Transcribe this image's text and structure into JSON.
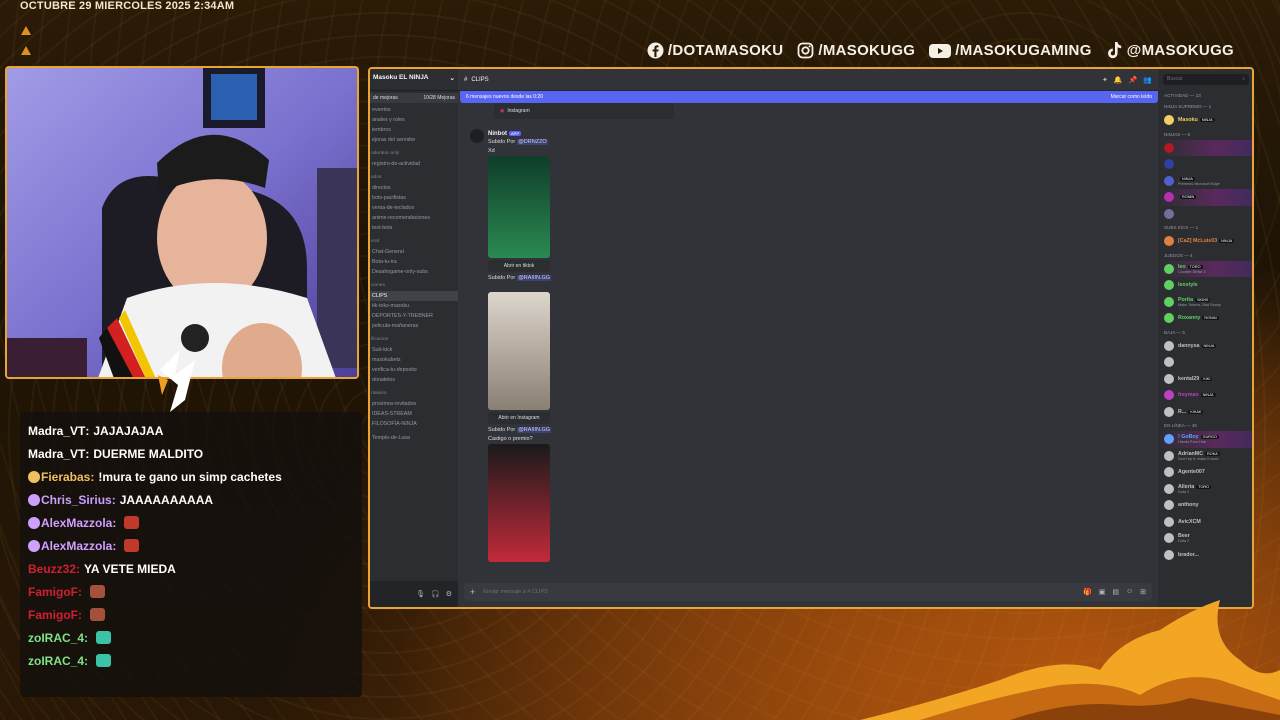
{
  "overlay": {
    "datetime": "OCTUBRE 29 MIERCOLES 2025 2:34AM",
    "socials": [
      {
        "icon": "facebook-icon",
        "label": "/DOTAMASOKU"
      },
      {
        "icon": "instagram-icon",
        "label": "/MASOKUGG"
      },
      {
        "icon": "youtube-icon",
        "label": "/MASOKUGAMING"
      },
      {
        "icon": "tiktok-icon",
        "label": "@MASOKUGG"
      }
    ],
    "accent_color": "#e6a534"
  },
  "chat": {
    "messages": [
      {
        "user": "Madra_VT",
        "color": "#ffffff",
        "badge": "",
        "text": "JAJAJAJAA",
        "emote": ""
      },
      {
        "user": "Madra_VT",
        "color": "#ffffff",
        "badge": "",
        "text": "DUERME MALDITO",
        "emote": ""
      },
      {
        "user": "Fierabas",
        "color": "#f0c060",
        "badge": "badge-icon",
        "text": "!mura te gano un simp cachetes",
        "emote": ""
      },
      {
        "user": "Chris_Sirius",
        "color": "#c9a0ff",
        "badge": "badge-icon",
        "text": "JAAAAAAAAAA",
        "emote": ""
      },
      {
        "user": "AlexMazzola",
        "color": "#d0a0ff",
        "badge": "badge-icon",
        "text": "",
        "emote": "emote-icon"
      },
      {
        "user": "AlexMazzola",
        "color": "#d0a0ff",
        "badge": "badge-icon",
        "text": "",
        "emote": "emote-icon"
      },
      {
        "user": "Beuzz32",
        "color": "#d02030",
        "badge": "",
        "text": "YA VETE MIEDA",
        "emote": ""
      },
      {
        "user": "FamigoF",
        "color": "#d02030",
        "badge": "",
        "text": "",
        "emote": "emote-icon"
      },
      {
        "user": "FamigoF",
        "color": "#d02030",
        "badge": "",
        "text": "",
        "emote": "emote-icon"
      },
      {
        "user": "zoIRAC_4",
        "color": "#7fe08a",
        "badge": "",
        "text": "",
        "emote": "emote-icon"
      },
      {
        "user": "zoIRAC_4",
        "color": "#7fe08a",
        "badge": "",
        "text": "",
        "emote": "emote-icon"
      }
    ]
  },
  "discord": {
    "server_name": "Masoku EL NINJA",
    "boost_label": "de mejoras",
    "boost_count": "10/28 Mejoras",
    "channels": [
      {
        "type": "ch",
        "label": "eventos"
      },
      {
        "type": "ch",
        "label": "anales y roles"
      },
      {
        "type": "ch",
        "label": "iembros"
      },
      {
        "type": "ch",
        "label": "ejoras del servidor"
      },
      {
        "type": "gap"
      },
      {
        "type": "cat",
        "label": "oderator-only"
      },
      {
        "type": "ch",
        "label": "registro-de-actividad"
      },
      {
        "type": "gap"
      },
      {
        "type": "cat",
        "label": "ados"
      },
      {
        "type": "ch",
        "label": "directos"
      },
      {
        "type": "ch",
        "label": "bots-pacifistas"
      },
      {
        "type": "ch",
        "label": "venta-de-teclados"
      },
      {
        "type": "ch",
        "label": "anime-recomendaciones"
      },
      {
        "type": "ch",
        "label": "test-bots"
      },
      {
        "type": "gap"
      },
      {
        "type": "cat",
        "label": "eral"
      },
      {
        "type": "ch",
        "label": "Chat-General"
      },
      {
        "type": "ch",
        "label": "Bota-tu-ira"
      },
      {
        "type": "ch",
        "label": "Desahogame-only-subs"
      },
      {
        "type": "gap"
      },
      {
        "type": "cat",
        "label": "ciones"
      },
      {
        "type": "ch",
        "label": "CLIPS",
        "selected": true
      },
      {
        "type": "ch",
        "label": "tik-toks-masoku"
      },
      {
        "type": "ch",
        "label": "DEPORTES-Y-TREBNER"
      },
      {
        "type": "ch",
        "label": "pelicula-mañaneras"
      },
      {
        "type": "gap"
      },
      {
        "type": "cat",
        "label": "ificacion"
      },
      {
        "type": "ch",
        "label": "Sub-kick"
      },
      {
        "type": "ch",
        "label": "masokubets"
      },
      {
        "type": "ch",
        "label": "verifica-tu-deposito"
      },
      {
        "type": "ch",
        "label": "donatelos"
      },
      {
        "type": "gap"
      },
      {
        "type": "cat",
        "label": "ntasioo"
      },
      {
        "type": "ch",
        "label": "proximos-invitados"
      },
      {
        "type": "ch",
        "label": "IDEAS-STREAM"
      },
      {
        "type": "ch",
        "label": "FILOSOFÍA-NINJA"
      },
      {
        "type": "gap"
      },
      {
        "type": "ch",
        "label": "Templo-de-Lusa"
      }
    ],
    "channel_title": "CLIPS",
    "new_messages": "6 mensajes nuevos desde las 0:20",
    "mark_read": "Marcar como leído",
    "prev_embed": "Instagram",
    "bot_name": "Ninbot",
    "app_tag": "APP",
    "posts": [
      {
        "uploaded_by": "Subido Por",
        "uploader": "@DRNZZO",
        "caption": "Xd",
        "link": "Abrir en tiktok",
        "media_h": 102
      },
      {
        "uploaded_by": "Subido Por",
        "uploader": "@RAIIIN.GG",
        "caption": "",
        "link": "Abrir en Instagram",
        "media_h": 118
      },
      {
        "uploaded_by": "Subido Por",
        "uploader": "@RAIIIN.GG",
        "caption": "Castigo o premio?",
        "link": "",
        "media_h": 118
      }
    ],
    "composer_placeholder": "Enviar mensaje a #",
    "composer_channel": "CLIPS",
    "search_placeholder": "Buscar",
    "member_groups": [
      {
        "label": "Actividad — 23",
        "members": []
      },
      {
        "label": "NINJA SUPREMO — 1",
        "members": [
          {
            "name": "Masoku",
            "color": "#f0d060",
            "tag": "NINJA"
          }
        ]
      },
      {
        "label": "NINJAS — 5",
        "members": [
          {
            "name": "",
            "color": "#b01a20",
            "tag": "",
            "hl": true
          },
          {
            "name": "",
            "color": "#3040a0",
            "tag": ""
          },
          {
            "name": "",
            "color": "#5060d0",
            "tag": "NINJA",
            "sub": "Primeros Microsoft Edge"
          },
          {
            "name": "",
            "color": "#b030b0",
            "tag": "RONIN",
            "hl": true
          },
          {
            "name": "",
            "color": "#7070a0",
            "tag": ""
          }
        ]
      },
      {
        "label": "subs kick — 1",
        "members": [
          {
            "name": "[CaZ] McLuis03",
            "color": "#e08040",
            "tag": "NINJA"
          }
        ]
      },
      {
        "label": "JUEGOS — 4",
        "members": [
          {
            "name": "leo",
            "color": "#60d060",
            "tag": "TORO",
            "sub": "Counter-Strike 2",
            "hl": true
          },
          {
            "name": "leostyle",
            "color": "#60d060",
            "tag": ""
          },
          {
            "name": "Porita",
            "color": "#60d060",
            "tag": "SKINS",
            "sub": "Make Tokens, Bad Bunny"
          },
          {
            "name": "Roxanny",
            "color": "#60d060",
            "tag": "RONIN"
          }
        ]
      },
      {
        "label": "Baja — 5",
        "members": [
          {
            "name": "dannysa",
            "color": "#c0c0c0",
            "tag": "NINJA"
          },
          {
            "name": "",
            "color": "#c0c0c0",
            "tag": ""
          },
          {
            "name": "kental29",
            "color": "#c0c0c0",
            "tag": "KIKI"
          },
          {
            "name": "freyman",
            "color": "#c040c0",
            "tag": "NINJA"
          },
          {
            "name": "R...",
            "color": "#c0c0c0",
            "tag": "KIKAK"
          }
        ]
      },
      {
        "label": "En línea — 45",
        "members": [
          {
            "name": "! GoBoy",
            "color": "#60a0ff",
            "tag": "GURGO",
            "sub": "Hands Porn Hub",
            "hl": true
          },
          {
            "name": "AdrianMC",
            "color": "#c0c0c0",
            "tag": "ROKA",
            "sub": "Don't try it, make it work"
          },
          {
            "name": "Agente007",
            "color": "#c0c0c0",
            "tag": ""
          },
          {
            "name": "Alleria",
            "color": "#c0c0c0",
            "tag": "TORO",
            "sub": "Dota 2"
          },
          {
            "name": "anthony",
            "color": "#c0c0c0",
            "tag": ""
          },
          {
            "name": "AvicXCM",
            "color": "#c0c0c0",
            "tag": ""
          },
          {
            "name": "Beer",
            "color": "#c0c0c0",
            "tag": "",
            "sub": "Dota 2"
          },
          {
            "name": "brador...",
            "color": "#c0c0c0",
            "tag": ""
          }
        ]
      }
    ]
  }
}
